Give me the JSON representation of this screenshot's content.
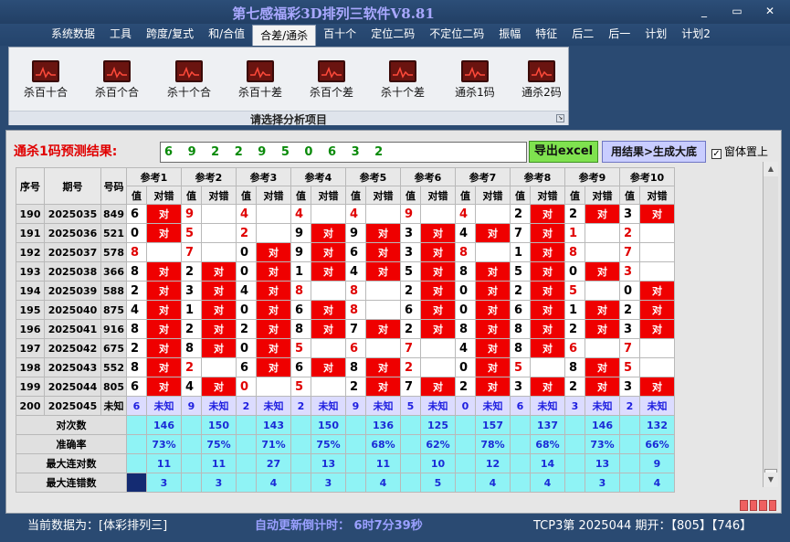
{
  "window": {
    "title": "第七感福彩3D排列三软件V8.81",
    "min_label": "_",
    "max_label": "▭",
    "close_label": "✕"
  },
  "menu": [
    {
      "label": "系统数据"
    },
    {
      "label": "工具"
    },
    {
      "label": "跨度/复式"
    },
    {
      "label": "和/合值"
    },
    {
      "label": "合差/通杀",
      "active": true
    },
    {
      "label": "百十个"
    },
    {
      "label": "定位二码"
    },
    {
      "label": "不定位二码"
    },
    {
      "label": "振幅"
    },
    {
      "label": "特征"
    },
    {
      "label": "后二"
    },
    {
      "label": "后一"
    },
    {
      "label": "计划"
    },
    {
      "label": "计划2"
    }
  ],
  "ribbon": {
    "buttons": [
      {
        "label": "杀百十合",
        "icon": "chart-icon"
      },
      {
        "label": "杀百个合",
        "icon": "chart-icon"
      },
      {
        "label": "杀十个合",
        "icon": "chart-icon"
      },
      {
        "label": "杀百十差",
        "icon": "chart-icon"
      },
      {
        "label": "杀百个差",
        "icon": "chart-icon"
      },
      {
        "label": "杀十个差",
        "icon": "chart-icon"
      },
      {
        "label": "通杀1码",
        "icon": "chart-icon"
      },
      {
        "label": "通杀2码",
        "icon": "chart-icon"
      }
    ],
    "group_label": "请选择分析项目"
  },
  "prediction": {
    "label": "通杀1码预测结果:",
    "value": "6 9 2 2 9 5 0 6 3 2",
    "excel_button": "导出excel",
    "generate_button": "用结果>生成大底",
    "topmost_checkbox": "窗体置上",
    "topmost_checked": true
  },
  "table": {
    "col_headers": {
      "seq": "序号",
      "period": "期号",
      "number": "号码",
      "value": "值",
      "result": "对错"
    },
    "refs": [
      "参考1",
      "参考2",
      "参考3",
      "参考4",
      "参考5",
      "参考6",
      "参考7",
      "参考8",
      "参考9",
      "参考10"
    ],
    "rows": [
      {
        "seq": "190",
        "period": "2025035",
        "number": "849",
        "cells": [
          [
            "6",
            "对"
          ],
          [
            "9",
            ""
          ],
          [
            "4",
            ""
          ],
          [
            "4",
            ""
          ],
          [
            "4",
            ""
          ],
          [
            "9",
            ""
          ],
          [
            "4",
            ""
          ],
          [
            "2",
            "对"
          ],
          [
            "2",
            "对"
          ],
          [
            "3",
            "对"
          ]
        ]
      },
      {
        "seq": "191",
        "period": "2025036",
        "number": "521",
        "cells": [
          [
            "0",
            "对"
          ],
          [
            "5",
            ""
          ],
          [
            "2",
            ""
          ],
          [
            "9",
            "对"
          ],
          [
            "9",
            "对"
          ],
          [
            "3",
            "对"
          ],
          [
            "4",
            "对"
          ],
          [
            "7",
            "对"
          ],
          [
            "1",
            ""
          ],
          [
            "2",
            ""
          ]
        ]
      },
      {
        "seq": "192",
        "period": "2025037",
        "number": "578",
        "cells": [
          [
            "8",
            ""
          ],
          [
            "7",
            ""
          ],
          [
            "0",
            "对"
          ],
          [
            "9",
            "对"
          ],
          [
            "6",
            "对"
          ],
          [
            "3",
            "对"
          ],
          [
            "8",
            ""
          ],
          [
            "1",
            "对"
          ],
          [
            "8",
            ""
          ],
          [
            "7",
            ""
          ]
        ]
      },
      {
        "seq": "193",
        "period": "2025038",
        "number": "366",
        "cells": [
          [
            "8",
            "对"
          ],
          [
            "2",
            "对"
          ],
          [
            "0",
            "对"
          ],
          [
            "1",
            "对"
          ],
          [
            "4",
            "对"
          ],
          [
            "5",
            "对"
          ],
          [
            "8",
            "对"
          ],
          [
            "5",
            "对"
          ],
          [
            "0",
            "对"
          ],
          [
            "3",
            ""
          ]
        ]
      },
      {
        "seq": "194",
        "period": "2025039",
        "number": "588",
        "cells": [
          [
            "2",
            "对"
          ],
          [
            "3",
            "对"
          ],
          [
            "4",
            "对"
          ],
          [
            "8",
            ""
          ],
          [
            "8",
            ""
          ],
          [
            "2",
            "对"
          ],
          [
            "0",
            "对"
          ],
          [
            "2",
            "对"
          ],
          [
            "5",
            ""
          ],
          [
            "0",
            "对"
          ]
        ]
      },
      {
        "seq": "195",
        "period": "2025040",
        "number": "875",
        "cells": [
          [
            "4",
            "对"
          ],
          [
            "1",
            "对"
          ],
          [
            "0",
            "对"
          ],
          [
            "6",
            "对"
          ],
          [
            "8",
            ""
          ],
          [
            "6",
            "对"
          ],
          [
            "0",
            "对"
          ],
          [
            "6",
            "对"
          ],
          [
            "1",
            "对"
          ],
          [
            "2",
            "对"
          ]
        ]
      },
      {
        "seq": "196",
        "period": "2025041",
        "number": "916",
        "cells": [
          [
            "8",
            "对"
          ],
          [
            "2",
            "对"
          ],
          [
            "2",
            "对"
          ],
          [
            "8",
            "对"
          ],
          [
            "7",
            "对"
          ],
          [
            "2",
            "对"
          ],
          [
            "8",
            "对"
          ],
          [
            "8",
            "对"
          ],
          [
            "2",
            "对"
          ],
          [
            "3",
            "对"
          ]
        ]
      },
      {
        "seq": "197",
        "period": "2025042",
        "number": "675",
        "cells": [
          [
            "2",
            "对"
          ],
          [
            "8",
            "对"
          ],
          [
            "0",
            "对"
          ],
          [
            "5",
            ""
          ],
          [
            "6",
            ""
          ],
          [
            "7",
            ""
          ],
          [
            "4",
            "对"
          ],
          [
            "8",
            "对"
          ],
          [
            "6",
            ""
          ],
          [
            "7",
            ""
          ]
        ]
      },
      {
        "seq": "198",
        "period": "2025043",
        "number": "552",
        "cells": [
          [
            "8",
            "对"
          ],
          [
            "2",
            ""
          ],
          [
            "6",
            "对"
          ],
          [
            "6",
            "对"
          ],
          [
            "8",
            "对"
          ],
          [
            "2",
            ""
          ],
          [
            "0",
            "对"
          ],
          [
            "5",
            ""
          ],
          [
            "8",
            "对"
          ],
          [
            "5",
            ""
          ]
        ]
      },
      {
        "seq": "199",
        "period": "2025044",
        "number": "805",
        "cells": [
          [
            "6",
            "对"
          ],
          [
            "4",
            "对"
          ],
          [
            "0",
            ""
          ],
          [
            "5",
            ""
          ],
          [
            "2",
            "对"
          ],
          [
            "7",
            "对"
          ],
          [
            "2",
            "对"
          ],
          [
            "3",
            "对"
          ],
          [
            "2",
            "对"
          ],
          [
            "3",
            "对"
          ]
        ]
      }
    ],
    "current": {
      "seq": "200",
      "period": "2025045",
      "number": "未知",
      "values": [
        "6",
        "9",
        "2",
        "2",
        "9",
        "5",
        "0",
        "6",
        "3",
        "2"
      ],
      "unknown": "未知"
    },
    "stats": [
      {
        "label": "对次数",
        "values": [
          "146",
          "150",
          "143",
          "150",
          "136",
          "125",
          "157",
          "137",
          "146",
          "132"
        ]
      },
      {
        "label": "准确率",
        "values": [
          "73%",
          "75%",
          "71%",
          "75%",
          "68%",
          "62%",
          "78%",
          "68%",
          "73%",
          "66%"
        ]
      },
      {
        "label": "最大连对数",
        "values": [
          "11",
          "11",
          "27",
          "13",
          "11",
          "10",
          "12",
          "14",
          "13",
          "9"
        ]
      },
      {
        "label": "最大连错数",
        "values": [
          "3",
          "3",
          "4",
          "3",
          "4",
          "5",
          "4",
          "4",
          "3",
          "4"
        ]
      }
    ]
  },
  "status": {
    "data_source": "当前数据为：[体彩排列三]",
    "countdown": "自动更新倒计时：   6时7分39秒",
    "draw_info": "TCP3第 2025044 期开：【805】【746】"
  },
  "colors": {
    "accent_red": "#ef0000",
    "stat_cyan": "#8ff3f5",
    "unknown_bg": "#dcdcff",
    "title_purple": "#a9a8ff"
  }
}
